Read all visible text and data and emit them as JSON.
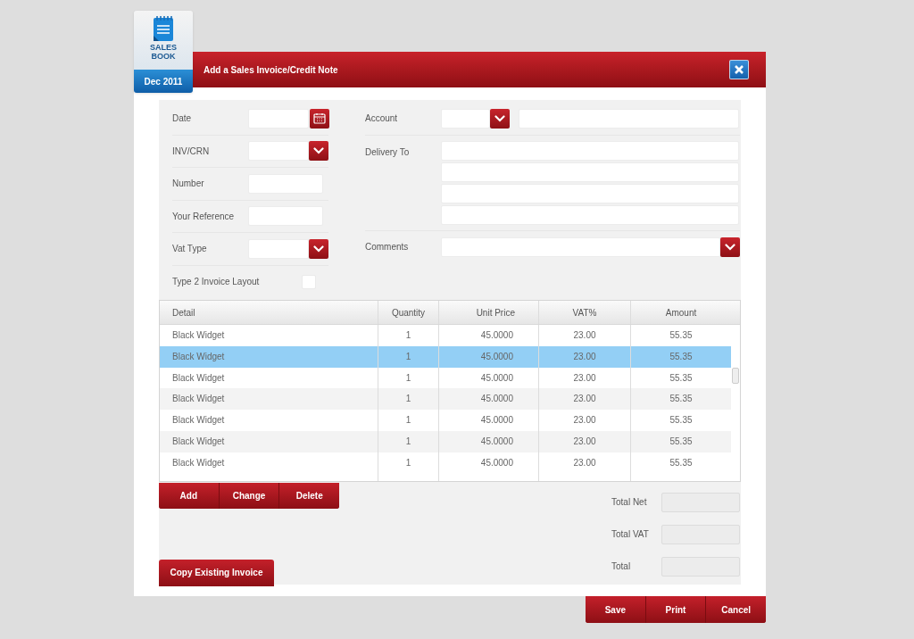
{
  "badge": {
    "title": "SALES BOOK",
    "period": "Dec 2011"
  },
  "window": {
    "title": "Add a Sales Invoice/Credit Note"
  },
  "form_left": [
    {
      "label": "Date",
      "kind": "date"
    },
    {
      "label": "INV/CRN",
      "kind": "select"
    },
    {
      "label": "Number",
      "kind": "text"
    },
    {
      "label": "Your Reference",
      "kind": "text"
    },
    {
      "label": "Vat Type",
      "kind": "select"
    },
    {
      "label": "Type 2 Invoice Layout",
      "kind": "checkbox",
      "checked": false
    }
  ],
  "form_right": {
    "account_label": "Account",
    "delivery_label": "Delivery To",
    "comments_label": "Comments"
  },
  "table": {
    "columns": [
      "Detail",
      "Quantity",
      "Unit Price",
      "VAT%",
      "Amount"
    ],
    "rows": [
      {
        "cells": [
          "Black Widget",
          "1",
          "45.0000",
          "23.00",
          "55.35"
        ],
        "selected": false
      },
      {
        "cells": [
          "Black Widget",
          "1",
          "45.0000",
          "23.00",
          "55.35"
        ],
        "selected": true
      },
      {
        "cells": [
          "Black Widget",
          "1",
          "45.0000",
          "23.00",
          "55.35"
        ],
        "selected": false
      },
      {
        "cells": [
          "Black Widget",
          "1",
          "45.0000",
          "23.00",
          "55.35"
        ],
        "selected": false
      },
      {
        "cells": [
          "Black Widget",
          "1",
          "45.0000",
          "23.00",
          "55.35"
        ],
        "selected": false
      },
      {
        "cells": [
          "Black Widget",
          "1",
          "45.0000",
          "23.00",
          "55.35"
        ],
        "selected": false
      },
      {
        "cells": [
          "Black Widget",
          "1",
          "45.0000",
          "23.00",
          "55.35"
        ],
        "selected": false
      }
    ]
  },
  "row_buttons": [
    "Add",
    "Change",
    "Delete"
  ],
  "copy_button": "Copy Existing Invoice",
  "totals": [
    "Total Net",
    "Total VAT",
    "Total"
  ],
  "footer_buttons": [
    "Save",
    "Print",
    "Cancel"
  ]
}
